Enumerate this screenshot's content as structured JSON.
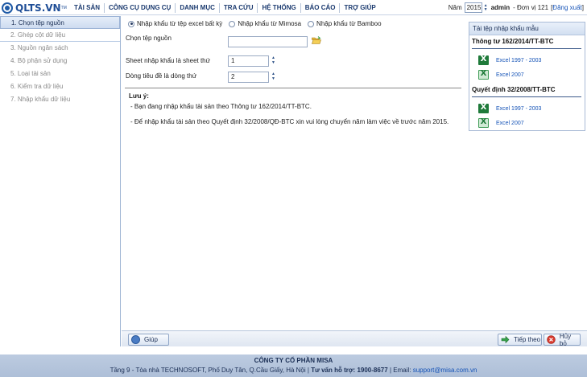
{
  "app": {
    "logo_text": "QLTS.VN",
    "logo_tm": "TM"
  },
  "menu": [
    "TÀI SẢN",
    "CÔNG CỤ DỤNG CỤ",
    "DANH MỤC",
    "TRA CỨU",
    "HỆ THỐNG",
    "BÁO CÁO",
    "TRỢ GIÚP"
  ],
  "header": {
    "year_label": "Năm",
    "year_value": "2015",
    "user": "admin",
    "unit": "- Đơn vị 121",
    "logout_open": "[",
    "logout_label": "Đăng xuất",
    "logout_close": "]"
  },
  "steps": [
    {
      "label": "1. Chọn tệp nguồn"
    },
    {
      "label": "2. Ghép cột dữ liệu"
    },
    {
      "label": "3. Nguồn ngân sách"
    },
    {
      "label": "4. Bộ phận sử dụng"
    },
    {
      "label": "5. Loại tài sản"
    },
    {
      "label": "6. Kiểm tra dữ liệu"
    },
    {
      "label": "7. Nhập khẩu dữ liệu"
    }
  ],
  "import_options": [
    {
      "label": "Nhập khẩu từ tệp excel bất kỳ",
      "checked": true
    },
    {
      "label": "Nhập khẩu từ Mimosa",
      "checked": false
    },
    {
      "label": "Nhập khẩu từ Bamboo",
      "checked": false
    }
  ],
  "form": {
    "source_label": "Chọn tệp nguồn",
    "source_value": "",
    "sheet_label": "Sheet nhập khẩu là sheet thứ",
    "sheet_value": "1",
    "header_row_label": "Dòng tiêu đề là dòng thứ",
    "header_row_value": "2"
  },
  "notes": {
    "title": "Lưu ý:",
    "lines": [
      "- Bạn đang nhập khẩu tài sản theo Thông tư 162/2014/TT-BTC.",
      "- Để nhập khẩu tài sản theo Quyết định 32/2008/QĐ-BTC xin vui lòng chuyển năm làm việc về trước năm 2015."
    ]
  },
  "template_panel": {
    "title": "Tải tệp nhập khẩu mẫu",
    "sections": [
      {
        "title": "Thông tư 162/2014/TT-BTC",
        "links": [
          "Excel 1997 - 2003",
          "Excel 2007"
        ]
      },
      {
        "title": "Quyết định 32/2008/TT-BTC",
        "links": [
          "Excel 1997 - 2003",
          "Excel 2007"
        ]
      }
    ]
  },
  "buttons": {
    "help": "Giúp",
    "next": "Tiếp theo",
    "cancel": "Hủy bỏ"
  },
  "footer": {
    "company": "CÔNG TY CỔ PHẦN MISA",
    "address": "Tầng 9 - Tòa nhà TECHNOSOFT, Phố Duy Tân, Q.Cầu Giấy, Hà Nội",
    "sep": "|",
    "hotline": "Tư vấn hỗ trợ: 1900-8677",
    "email_label": "| Email:",
    "email": "support@misa.com.vn"
  },
  "colors": {
    "brand": "#1e4d96",
    "accent": "#1553b7",
    "excel_green": "#1f7a3a"
  },
  "icons": {
    "folder": "folder-open-icon",
    "excel": "excel-icon",
    "help": "help-icon",
    "next": "arrow-right-icon",
    "cancel": "cancel-icon"
  }
}
